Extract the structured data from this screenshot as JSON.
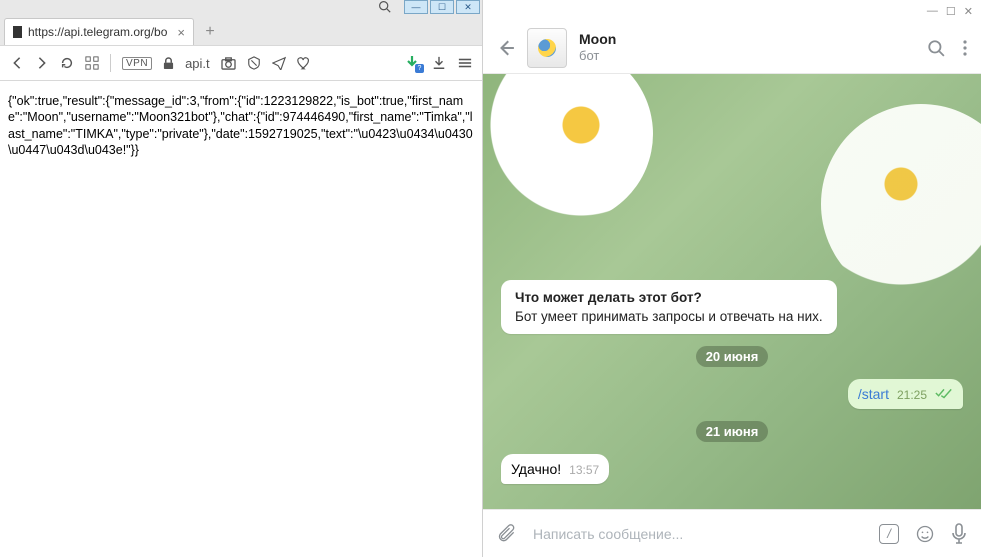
{
  "browser": {
    "tab": {
      "url": "https://api.telegram.org/bo"
    },
    "toolbar": {
      "host": "api.t"
    },
    "body_text": "{\"ok\":true,\"result\":{\"message_id\":3,\"from\":{\"id\":1223129822,\"is_bot\":true,\"first_name\":\"Moon\",\"username\":\"Moon321bot\"},\"chat\":{\"id\":974446490,\"first_name\":\"Timka\",\"last_name\":\"TIMKA\",\"type\":\"private\"},\"date\":1592719025,\"text\":\"\\u0423\\u0434\\u0430\\u0447\\u043d\\u043e!\"}}"
  },
  "telegram": {
    "header": {
      "name": "Moon",
      "subtitle": "бот"
    },
    "bot_card": {
      "question": "Что может делать этот бот?",
      "desc": "Бот умеет принимать запросы и отвечать на них."
    },
    "dates": {
      "d1": "20 июня",
      "d2": "21 июня"
    },
    "msg_start": {
      "text": "/start",
      "time": "21:25"
    },
    "msg_reply": {
      "text": "Удачно!",
      "time": "13:57"
    },
    "input": {
      "placeholder": "Написать сообщение..."
    }
  }
}
